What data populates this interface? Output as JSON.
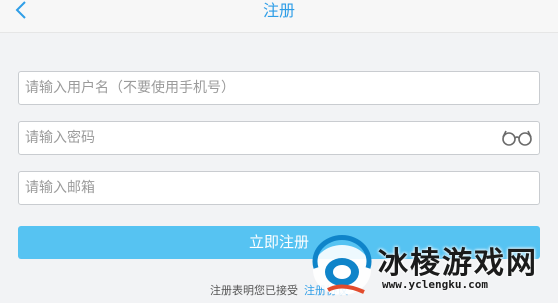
{
  "nav": {
    "title": "注册",
    "back_icon": "chevron-left-icon"
  },
  "form": {
    "username": {
      "placeholder": "请输入用户名（不要使用手机号）",
      "value": ""
    },
    "password": {
      "placeholder": "请输入密码",
      "value": "",
      "toggle_icon": "glasses-icon"
    },
    "email": {
      "placeholder": "请输入邮箱",
      "value": ""
    },
    "submit_label": "立即注册"
  },
  "agreement": {
    "text": "注册表明您已接受",
    "link_label": "注册协议"
  },
  "watermark": {
    "title": "冰棱游戏网",
    "url": "www.yclengku.com"
  },
  "colors": {
    "accent": "#2f9ee7",
    "button": "#56c3f2",
    "background": "#f2f3f5"
  }
}
